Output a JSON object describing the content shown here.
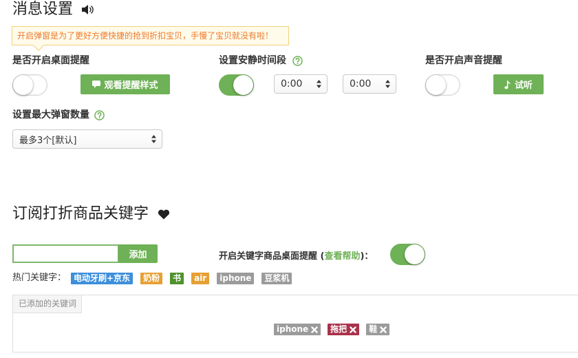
{
  "colors": {
    "accent": "#6eb156",
    "tooltip_text": "#ec7a2e",
    "tooltip_background": "#fffbea",
    "tooltip_border": "#f1cf7a"
  },
  "message_settings": {
    "title": "消息设置",
    "title_icon": "speaker-icon",
    "tooltip": "开启弹窗是为了更好方便快捷的抢到折扣宝贝，手慢了宝贝就没有啦！",
    "desktop_alert": {
      "label": "是否开启桌面提醒",
      "enabled": false,
      "preview_button": {
        "icon": "comment-icon",
        "label": "观看提醒样式"
      }
    },
    "quiet_hours": {
      "label": "设置安静时间段",
      "help_icon": "question-circle-icon",
      "enabled": true,
      "start": "0:00",
      "end": "0:00"
    },
    "sound_alert": {
      "label": "是否开启声音提醒",
      "enabled": false,
      "test_button": {
        "icon": "music-note-icon",
        "label": "试听"
      }
    },
    "max_popups": {
      "label": "设置最大弹窗数量",
      "help_icon": "question-circle-icon",
      "selected": "最多3个[默认]"
    }
  },
  "keyword_subscription": {
    "title": "订阅打折商品关键字",
    "title_icon": "heart-icon",
    "add_button": "添加",
    "keyword_alert": {
      "label_prefix": "开启关键字商品桌面提醒 (",
      "help_link": "查看帮助",
      "label_suffix": ")：",
      "enabled": true
    },
    "hot_keywords_label": "热门关键字：",
    "hot_keywords": [
      {
        "text": "电动牙刷+京东",
        "color": "#3d8fdb"
      },
      {
        "text": "奶粉",
        "color": "#e6a034"
      },
      {
        "text": "书",
        "color": "#4f922c"
      },
      {
        "text": "air",
        "color": "#e6a034"
      },
      {
        "text": "iphone",
        "color": "#9b9b9b"
      },
      {
        "text": "豆浆机",
        "color": "#9b9b9b"
      }
    ],
    "added_panel_title": "已添加的关键词",
    "added_keywords": [
      {
        "text": "iphone",
        "color": "#9b9b9b"
      },
      {
        "text": "拖把",
        "color": "#a9324b"
      },
      {
        "text": "鞋",
        "color": "#9b9b9b"
      }
    ]
  }
}
